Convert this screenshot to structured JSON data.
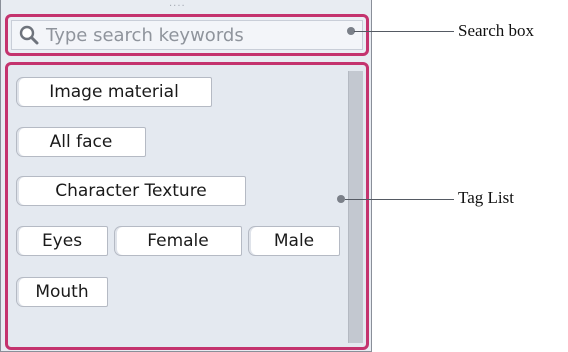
{
  "search": {
    "placeholder": "Type search keywords"
  },
  "tags": [
    {
      "label": "Image material"
    },
    {
      "label": "All face"
    },
    {
      "label": "Character Texture"
    },
    {
      "label": "Eyes"
    },
    {
      "label": "Female"
    },
    {
      "label": "Male"
    },
    {
      "label": "Mouth"
    }
  ],
  "callouts": {
    "search_box": "Search box",
    "tag_list": "Tag List"
  },
  "colors": {
    "highlight": "#c4336e",
    "panel_bg": "#e4e9f0"
  },
  "icons": {
    "search": "search-icon"
  }
}
